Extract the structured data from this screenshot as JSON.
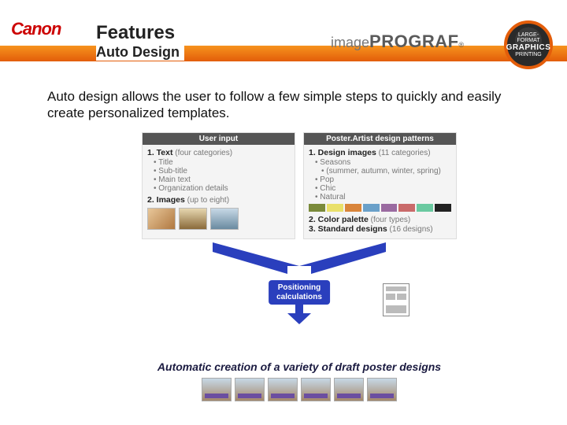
{
  "header": {
    "brand": "Canon",
    "title": "Features",
    "subtitle": "Auto Design",
    "product_line_a": "image",
    "product_line_b": "PROGRAF",
    "seal_top": "LARGE-FORMAT",
    "seal_mid": "GRAPHICS",
    "seal_bot": "PRINTING"
  },
  "intro": "Auto design allows the user to follow a few simple steps to quickly and easily create personalized templates.",
  "left_col": {
    "head": "User input",
    "item1_label": "1. Text",
    "item1_note": " (four categories)",
    "bullets1": [
      "Title",
      "Sub-title",
      "Main text",
      "Organization details"
    ],
    "item2_label": "2. Images",
    "item2_note": " (up to eight)"
  },
  "right_col": {
    "head": "Poster.Artist design patterns",
    "item1_label": "1. Design images",
    "item1_note": " (11 categories)",
    "bullets1": [
      "Seasons",
      "(summer, autumn, winter, spring)",
      "Pop",
      "Chic",
      "Natural"
    ],
    "item2_label": "2. Color palette",
    "item2_note": " (four types)",
    "item3_label": "3. Standard designs",
    "item3_note": " (16 designs)"
  },
  "positioning": "Positioning\ncalculations",
  "result": "Automatic creation of a variety of draft poster designs",
  "palette": [
    "#7a8a3a",
    "#e9e06a",
    "#d9843a",
    "#6aa0c9",
    "#9a6aa0",
    "#c96a6a",
    "#6ac9a0",
    "#222"
  ]
}
